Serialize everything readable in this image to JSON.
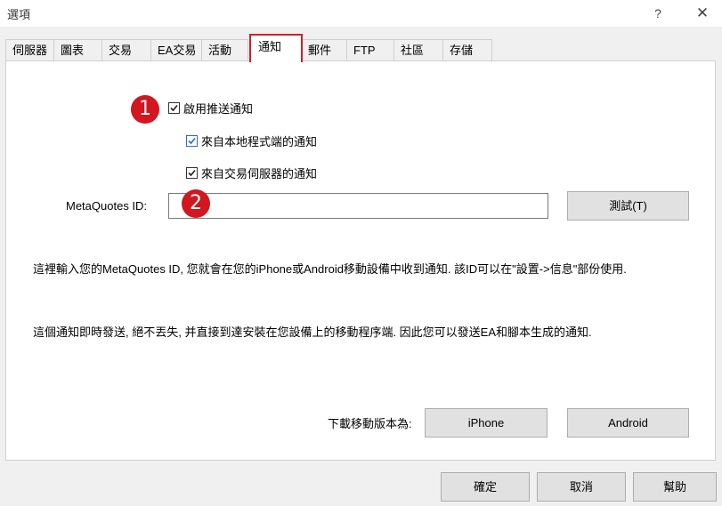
{
  "window": {
    "title": "選項",
    "help_glyph": "?",
    "close_glyph": "✕"
  },
  "tabs": [
    {
      "label": "伺服器"
    },
    {
      "label": "圖表"
    },
    {
      "label": "交易"
    },
    {
      "label": "EA交易"
    },
    {
      "label": "活動"
    },
    {
      "label": "通知",
      "active": true
    },
    {
      "label": "郵件"
    },
    {
      "label": "FTP"
    },
    {
      "label": "社區"
    },
    {
      "label": "存儲"
    }
  ],
  "notifications": {
    "enable_push": {
      "label": "啟用推送通知",
      "checked": true
    },
    "from_local": {
      "label": "來自本地程式端的通知",
      "checked": true
    },
    "from_server": {
      "label": "來自交易伺服器的通知",
      "checked": true
    },
    "id_label": "MetaQuotes ID:",
    "id_value": "",
    "test_button": "測試(T)",
    "info_text_1": "這裡輸入您的MetaQuotes ID, 您就會在您的iPhone或Android移動設備中收到通知. 該ID可以在\"設置->信息\"部份使用.",
    "info_text_2": "這個通知即時發送, 絕不丟失, 并直接到達安裝在您設備上的移動程序端. 因此您可以發送EA和腳本生成的通知.",
    "download_label": "下載移動版本為:",
    "iphone_button": "iPhone",
    "android_button": "Android"
  },
  "annotations": {
    "badge_1": "1",
    "badge_2": "2",
    "badge_color": "#d3161f"
  },
  "footer": {
    "ok_button": "確定",
    "cancel_button": "取消",
    "help_button": "幫助"
  },
  "colors": {
    "active_tab_border": "#d0202a",
    "checkbox_blue": "#2b6fbd"
  }
}
